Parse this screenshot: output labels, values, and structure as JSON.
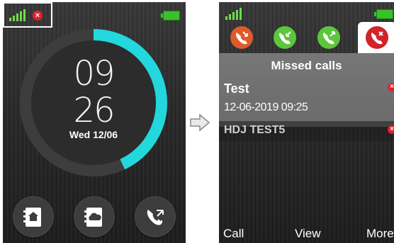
{
  "home": {
    "clock": {
      "hours": "09",
      "minutes": "26",
      "date": "Wed 12/06"
    },
    "progress_fraction": 0.43
  },
  "missed": {
    "title": "Missed calls",
    "entries": [
      {
        "name": "Test",
        "time": "12-06-2019 09:25"
      },
      {
        "name": "HDJ TEST5"
      }
    ],
    "softkeys": {
      "left": "Call",
      "middle": "View",
      "right": "More"
    }
  },
  "colors": {
    "ring_accent": "#22d8dc",
    "signal_green": "#6ddc4a",
    "tab_orange": "#e05a2a",
    "tab_green": "#5cc63c",
    "tab_red": "#d2222a",
    "error_red": "#e3202a"
  },
  "icons": {
    "status": [
      "signal-icon",
      "error-x-icon",
      "battery-icon"
    ],
    "home_buttons": [
      "contacts-book-icon",
      "cloud-book-icon",
      "missed-call-icon"
    ],
    "tabs": [
      "missed-call-icon",
      "received-call-icon",
      "dialed-call-icon",
      "missed-call-icon"
    ]
  }
}
